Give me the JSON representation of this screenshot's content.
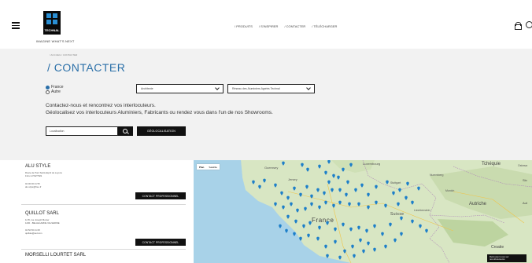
{
  "header": {
    "logo_text": "TECHNAL",
    "tagline": "IMAGINE WHAT'S NEXT",
    "nav": [
      {
        "label": "/ PRODUITS"
      },
      {
        "label": "/ S'INSPIRER"
      },
      {
        "label": "/ CONTACTER"
      },
      {
        "label": "/ TÉLÉCHARGER"
      }
    ]
  },
  "breadcrumb": "/ ACCUEIL / CONTACTER",
  "page_title": "/ CONTACTER",
  "location_options": [
    {
      "label": "France",
      "checked": true
    },
    {
      "label": "Autre",
      "checked": false
    }
  ],
  "filters": {
    "profile_select": "Architecte",
    "network_select": "Réseau des Aluminiers Agréés Technal"
  },
  "intro": {
    "line1": "Contactez-nous et rencontrez vos interlocuteurs.",
    "line2": "Géolocalisez vos interlocuteurs Aluminiers, Fabricants ou rendez vous dans l'un de nos Showrooms."
  },
  "search": {
    "placeholder": "Localisation",
    "geo_button": "GÉOLOCALISATION"
  },
  "results": [
    {
      "name": "ALU STYLE",
      "address": "Route de Pont Saint-Esprit de Loyons\n13xx LOYETTES",
      "contact": "04 00 00 21 55\nalu.style@free.fr",
      "button": "CONTACT PROFESSIONNEL"
    },
    {
      "name": "QUILLOT SARL",
      "address": "12 B, rue Joseph Monier\n1200 - BELLEGARDE VALSERINE",
      "contact": "04 50 56 21 08\nquillote@aol.com",
      "button": "CONTACT PROFESSIONNEL"
    },
    {
      "name": "MORSELLI LOURTET SARL",
      "address": "",
      "contact": "",
      "button": ""
    }
  ],
  "map": {
    "toggle": [
      "Plan",
      "Satellite"
    ],
    "labels": {
      "guernesey": "Guernsey",
      "jersey": "Jersey",
      "france": "France",
      "suisse": "Suisse",
      "luxembourg": "Luxembourg",
      "tcheque": "Tchéquie",
      "autriche": "Autriche",
      "liechtenstein": "Liechtenstein",
      "croatie": "Croatie",
      "nuremberg": "Nuremberg",
      "stuttgart": "Stuttgart",
      "munich": "Munich",
      "slov": "Slo",
      "hongrie": "Aut",
      "ostrava": "Ostrava"
    },
    "cta": "Retrouvez-nous sur\nnos showrooms"
  }
}
